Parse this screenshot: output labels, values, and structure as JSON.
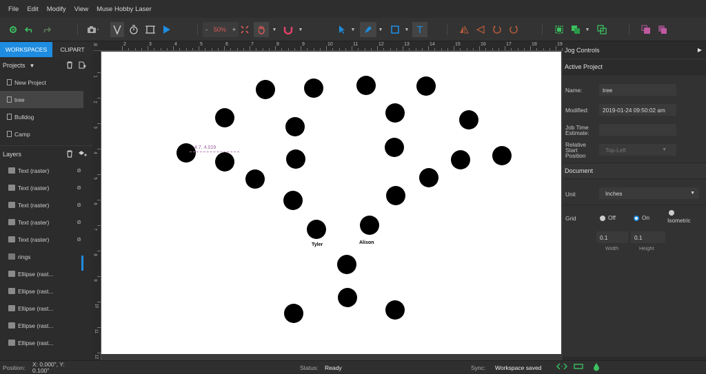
{
  "menu": {
    "file": "File",
    "edit": "Edit",
    "modify": "Modify",
    "view": "View",
    "app": "Muse Hobby Laser"
  },
  "toolbar": {
    "zoom_minus": "-",
    "zoom_value": "50%",
    "zoom_plus": "+",
    "text_tool": "T"
  },
  "workspace_tabs": {
    "workspaces": "WORKSPACES",
    "clipart": "CLIPART"
  },
  "projects": {
    "header": "Projects",
    "items": [
      "New Project",
      "tree",
      "Bulldog",
      "Camp"
    ]
  },
  "layers": {
    "header": "Layers",
    "items": [
      "Text (raster)",
      "Text (raster)",
      "Text (raster)",
      "Text (raster)",
      "Text (raster)",
      "rings",
      "Ellipse (rast...",
      "Ellipse (rast...",
      "Ellipse (rast...",
      "Ellipse (rast...",
      "Ellipse (rast..."
    ]
  },
  "ruler": {
    "unit_label": "in",
    "top_ticks": [
      "2",
      "3",
      "4",
      "5",
      "6",
      "7",
      "8",
      "9",
      "10",
      "11",
      "12",
      "13",
      "14",
      "15",
      "16",
      "17",
      "18",
      "19"
    ],
    "left_ticks": [
      "1",
      "2",
      "3",
      "4",
      "5",
      "6",
      "7",
      "8",
      "9",
      "10",
      "11",
      "12"
    ]
  },
  "canvas": {
    "coord_label": "4.7, 4.019",
    "captions": {
      "tyler": "Tyler",
      "alison": "Alison"
    }
  },
  "jog_controls": {
    "header": "Jog Controls"
  },
  "active_project": {
    "header": "Active Project",
    "name_label": "Name:",
    "name_value": "tree",
    "modified_label": "Modified:",
    "modified_value": "2019-01-24 09:50:02 am",
    "job_time_label": "Job Time Estimate:",
    "start_label": "Relative Start Position",
    "start_value": "Top-Left"
  },
  "document": {
    "header": "Document",
    "unit_label": "Unit",
    "unit_value": "Inches",
    "grid_label": "Grid",
    "grid_options": [
      "Off",
      "On",
      "Isometric"
    ],
    "grid_selected": "On",
    "width_value": "0.1",
    "height_value": "0.1",
    "width_label": "Width",
    "height_label": "Height"
  },
  "status": {
    "position_label": "Position:",
    "position_value": "X: 0.000\", Y: 0.100\"",
    "status_label": "Status:",
    "status_value": "Ready",
    "sync_label": "Sync:",
    "sync_value": "Workspace saved"
  },
  "colors": {
    "accent": "#1e8ce0",
    "zoom": "#e05a5a",
    "canvas": "#ffffff",
    "green": "#3cc060"
  }
}
